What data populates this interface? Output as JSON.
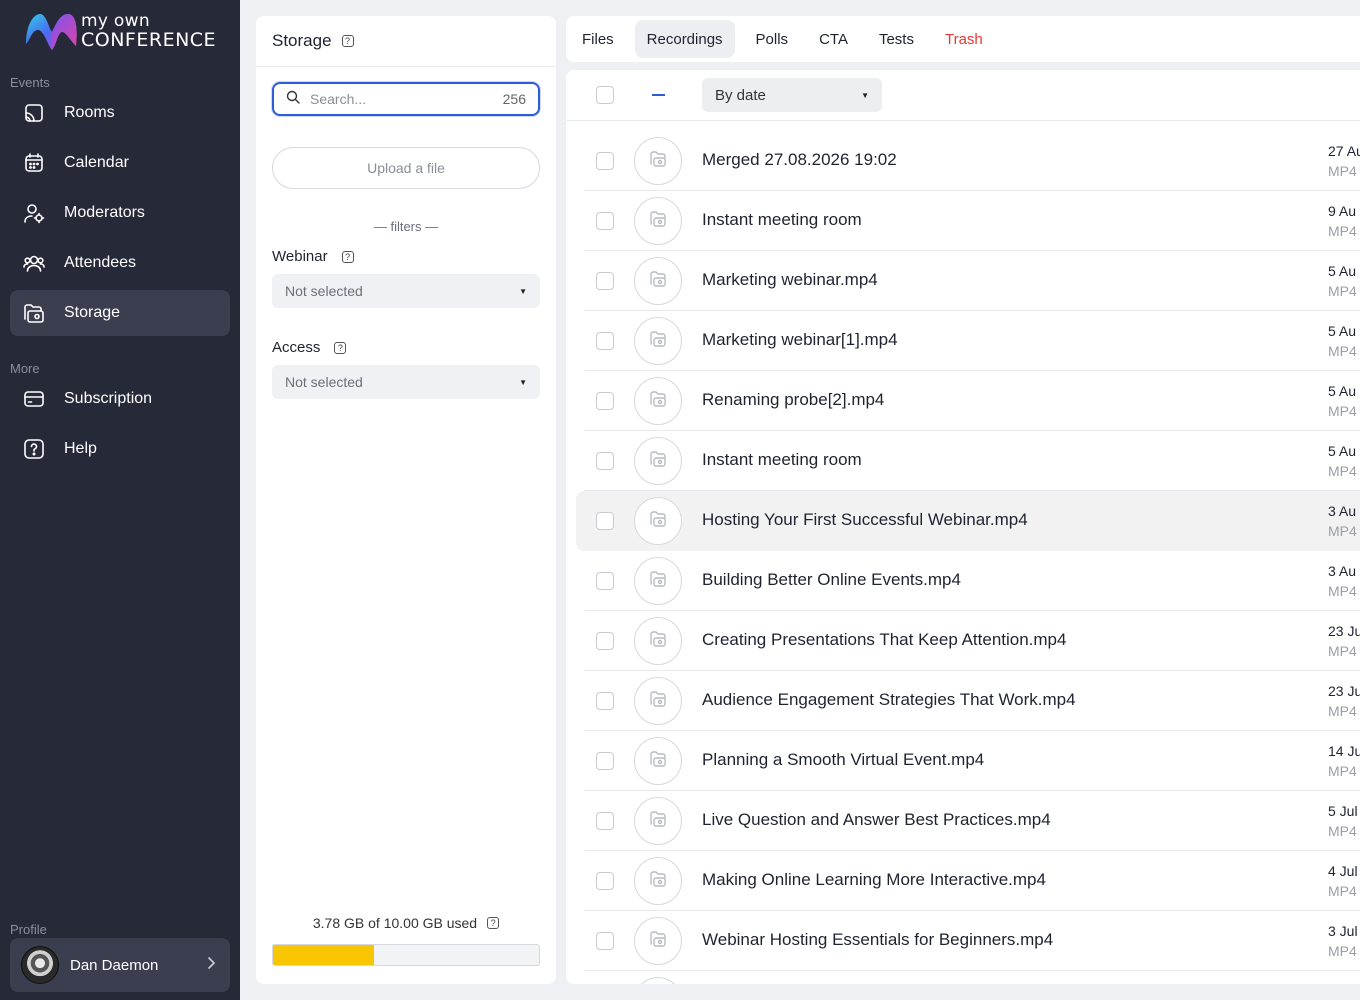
{
  "brand": {
    "line1": "my own",
    "line2": "CONFERENCE"
  },
  "sidebar": {
    "events_label": "Events",
    "more_label": "More",
    "profile_label": "Profile",
    "items": [
      {
        "label": "Rooms",
        "icon": "cast-icon"
      },
      {
        "label": "Calendar",
        "icon": "calendar-icon"
      },
      {
        "label": "Moderators",
        "icon": "moderator-icon"
      },
      {
        "label": "Attendees",
        "icon": "attendees-icon"
      },
      {
        "label": "Storage",
        "icon": "folder-icon",
        "active": true
      }
    ],
    "more_items": [
      {
        "label": "Subscription",
        "icon": "card-icon"
      },
      {
        "label": "Help",
        "icon": "help-icon"
      }
    ],
    "user": {
      "name": "Dan Daemon"
    }
  },
  "storage": {
    "title": "Storage",
    "search_placeholder": "Search...",
    "count": "256",
    "upload_label": "Upload a file",
    "filters_label": "— filters —",
    "webinar_label": "Webinar",
    "webinar_value": "Not selected",
    "access_label": "Access",
    "access_value": "Not selected",
    "usage_text": "3.78 GB of 10.00 GB used",
    "usage_fraction": 0.378
  },
  "tabs": [
    {
      "label": "Files"
    },
    {
      "label": "Recordings",
      "active": true
    },
    {
      "label": "Polls"
    },
    {
      "label": "CTA"
    },
    {
      "label": "Tests"
    },
    {
      "label": "Trash"
    }
  ],
  "list": {
    "sort_label": "By date",
    "rows": [
      {
        "title": "Merged 27.08.2026 19:02",
        "date": "27 Au",
        "type": "MP4"
      },
      {
        "title": "Instant meeting room",
        "date": "9 Au",
        "type": "MP4"
      },
      {
        "title": "Marketing webinar.mp4",
        "date": "5 Au",
        "type": "MP4"
      },
      {
        "title": "Marketing webinar[1].mp4",
        "date": "5 Au",
        "type": "MP4"
      },
      {
        "title": "Renaming probe[2].mp4",
        "date": "5 Au",
        "type": "MP4"
      },
      {
        "title": "Instant meeting room",
        "date": "5 Au",
        "type": "MP4"
      },
      {
        "title": "Hosting Your First Successful Webinar.mp4",
        "date": "3 Au",
        "type": "MP4",
        "highlighted": true
      },
      {
        "title": "Building Better Online Events.mp4",
        "date": "3 Au",
        "type": "MP4"
      },
      {
        "title": "Creating Presentations That Keep Attention.mp4",
        "date": "23 Ju",
        "type": "MP4"
      },
      {
        "title": "Audience Engagement Strategies That Work.mp4",
        "date": "23 Ju",
        "type": "MP4"
      },
      {
        "title": "Planning a Smooth Virtual Event.mp4",
        "date": "14 Ju",
        "type": "MP4"
      },
      {
        "title": "Live Question and Answer Best Practices.mp4",
        "date": "5 Jul",
        "type": "MP4"
      },
      {
        "title": "Making Online Learning More Interactive.mp4",
        "date": "4 Jul",
        "type": "MP4"
      },
      {
        "title": "Webinar Hosting Essentials for Beginners.mp4",
        "date": "3 Jul",
        "type": "MP4"
      },
      {
        "title": "",
        "date": "",
        "type": ""
      }
    ]
  },
  "colors": {
    "sidebar_bg": "#262938",
    "accent": "#2e5bd8",
    "trash": "#e53935",
    "usage_bar": "#f7c600"
  }
}
